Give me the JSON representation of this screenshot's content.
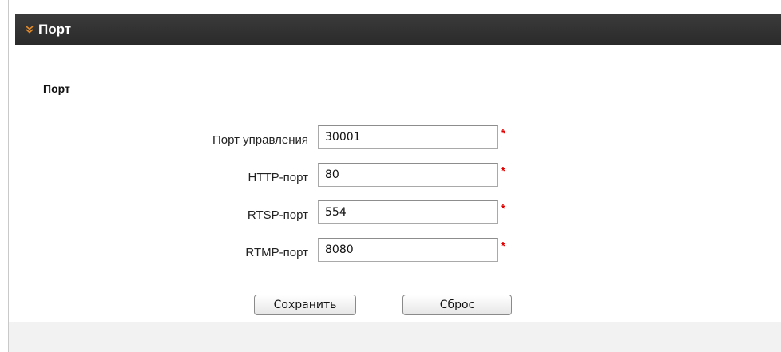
{
  "title_bar": {
    "title": "Порт",
    "icon": "chevron-double-down-icon"
  },
  "section": {
    "heading": "Порт"
  },
  "form": {
    "fields": [
      {
        "label": "Порт управления",
        "value": "30001",
        "required_mark": "*"
      },
      {
        "label": "HTTP-порт",
        "value": "80",
        "required_mark": "*"
      },
      {
        "label": "RTSP-порт",
        "value": "554",
        "required_mark": "*"
      },
      {
        "label": "RTMP-порт",
        "value": "8080",
        "required_mark": "*"
      }
    ]
  },
  "buttons": {
    "save_label": "Сохранить",
    "reset_label": "Сброс"
  },
  "colors": {
    "title_bar_bg": "#2f2f2f",
    "chevron": "#e08a2c",
    "required": "#e00000"
  }
}
